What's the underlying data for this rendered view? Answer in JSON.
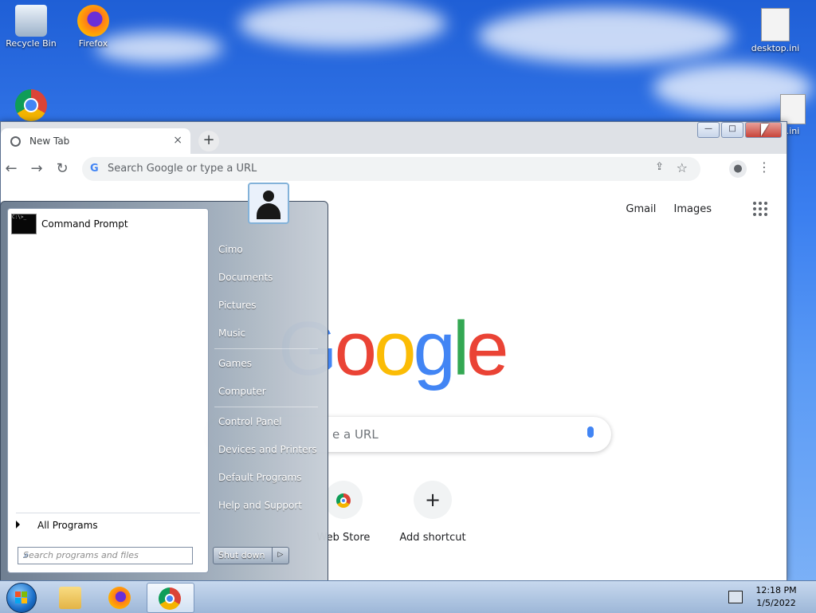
{
  "desktop": {
    "icons": [
      {
        "label": "Recycle Bin",
        "icon": "recycle-bin-icon"
      },
      {
        "label": "Firefox",
        "icon": "firefox-icon"
      },
      {
        "label": "desktop.ini",
        "icon": "file-icon"
      }
    ],
    "partial_label": ".ini"
  },
  "browser": {
    "tab_title": "New Tab",
    "tab_close": "×",
    "new_tab": "+",
    "window_controls": {
      "minimize": "—",
      "maximize": "□",
      "close": "✕"
    },
    "omnibox_placeholder": "Search Google or type a URL",
    "google_g": "G",
    "page": {
      "links": [
        "Gmail",
        "Images"
      ],
      "logo_letters": [
        "G",
        "o",
        "o",
        "g",
        "l",
        "e"
      ],
      "logo_colors": [
        "#4285f4",
        "#ea4335",
        "#fbbc05",
        "#4285f4",
        "#34a853",
        "#ea4335"
      ],
      "search_visible_text": "e a URL",
      "shortcuts": [
        {
          "label": "Web Store",
          "visible_label": "Web Store",
          "icon": "web-store-icon"
        },
        {
          "label": "Add shortcut",
          "icon": "plus-icon"
        }
      ],
      "plus_glyph": "+"
    }
  },
  "start_menu": {
    "pinned": [
      {
        "label": "Command Prompt",
        "icon": "command-prompt-icon",
        "icon_text": "C:\\>_"
      }
    ],
    "all_programs": "All Programs",
    "search_placeholder": "Search programs and files",
    "right_items": [
      "Cimo",
      "Documents",
      "Pictures",
      "Music",
      "Games",
      "Computer",
      "Control Panel",
      "Devices and Printers",
      "Default Programs",
      "Help and Support"
    ],
    "shutdown": "Shut down"
  },
  "taskbar": {
    "clock_time": "12:18 PM",
    "clock_date": "1/5/2022",
    "pinned": [
      "windows-explorer-icon",
      "firefox-icon",
      "chrome-icon"
    ],
    "active": "chrome-icon"
  }
}
